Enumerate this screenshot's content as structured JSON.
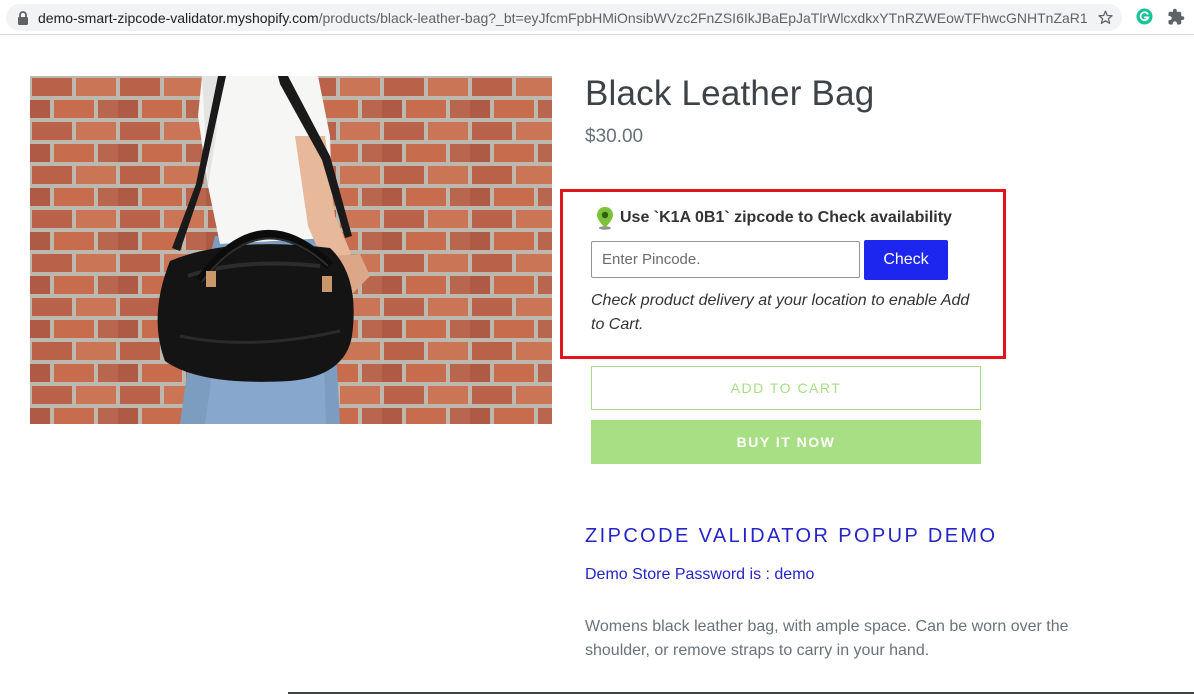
{
  "browser": {
    "url_host": "demo-smart-zipcode-validator.myshopify.com",
    "url_path": "/products/black-leather-bag?_bt=eyJfcmFpbHMiOnsibWVzc2FnZSI6IkJBaEpJaTlrWlcxdkxYTnRZWEowTFhwcGNHTnZaR1V..."
  },
  "product": {
    "title": "Black Leather Bag",
    "price": "$30.00",
    "description": "Womens black leather bag, with ample space. Can be worn over the shoulder, or remove straps to carry in your hand."
  },
  "zipcode_widget": {
    "heading": "Use `K1A 0B1` zipcode to Check availability",
    "input_value": "",
    "input_placeholder": "Enter Pincode.",
    "check_label": "Check",
    "note": "Check product delivery at your location to enable Add to Cart.",
    "border_color": "#e0151f",
    "button_color": "#1c26ee"
  },
  "actions": {
    "add_to_cart_label": "ADD TO CART",
    "buy_now_label": "BUY IT NOW",
    "accent_color": "#a8df85"
  },
  "demo": {
    "heading": "ZIPCODE VALIDATOR POPUP DEMO",
    "password_line": "Demo Store Password is : demo",
    "link_color": "#2525c7"
  },
  "icons": [
    "lock-icon",
    "bookmark-star-icon",
    "grammarly-extension-icon",
    "extensions-puzzle-icon",
    "location-pin-icon"
  ]
}
